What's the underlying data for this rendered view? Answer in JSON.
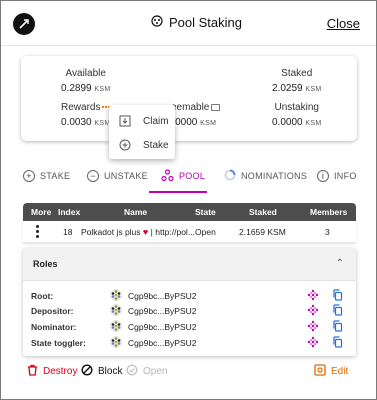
{
  "header": {
    "title": "Pool Staking",
    "close_label": "Close"
  },
  "balances": {
    "available": {
      "label": "Available",
      "value": "0.2899",
      "unit": "KSM"
    },
    "staked": {
      "label": "Staked",
      "value": "2.0259",
      "unit": "KSM"
    },
    "rewards": {
      "label": "Rewards",
      "value": "0.0030",
      "unit": "KSM"
    },
    "redeemable": {
      "label": "eemable",
      "value": "0000",
      "unit": "KSM"
    },
    "unstaking": {
      "label": "Unstaking",
      "value": "0.0000",
      "unit": "KSM"
    }
  },
  "popup": {
    "claim_label": "Claim",
    "stake_label": "Stake"
  },
  "tabs": {
    "stake": "STAKE",
    "unstake": "UNSTAKE",
    "pool": "POOL",
    "nominations": "NOMINATIONS",
    "info": "INFO",
    "active": "pool"
  },
  "table": {
    "headers": {
      "more": "More",
      "index": "Index",
      "name": "Name",
      "state": "State",
      "staked": "Staked",
      "members": "Members"
    },
    "row": {
      "index": "18",
      "name_part1": "Polkadot js plus",
      "name_part2": "| http://pol...",
      "state": "Open",
      "staked": "2.1659 KSM",
      "members": "3"
    }
  },
  "roles": {
    "title": "Roles",
    "items": [
      {
        "label": "Root:",
        "address": "Cgp9bc...ByPSU2"
      },
      {
        "label": "Depositor:",
        "address": "Cgp9bc...ByPSU2"
      },
      {
        "label": "Nominator:",
        "address": "Cgp9bc...ByPSU2"
      },
      {
        "label": "State toggler:",
        "address": "Cgp9bc...ByPSU2"
      }
    ]
  },
  "footer": {
    "destroy_label": "Destroy",
    "block_label": "Block",
    "open_label": "Open",
    "edit_label": "Edit"
  },
  "colors": {
    "accent": "#c100b6",
    "destroy": "#d8001c",
    "edit": "#e06a00",
    "table_header": "#4d4d4d"
  }
}
